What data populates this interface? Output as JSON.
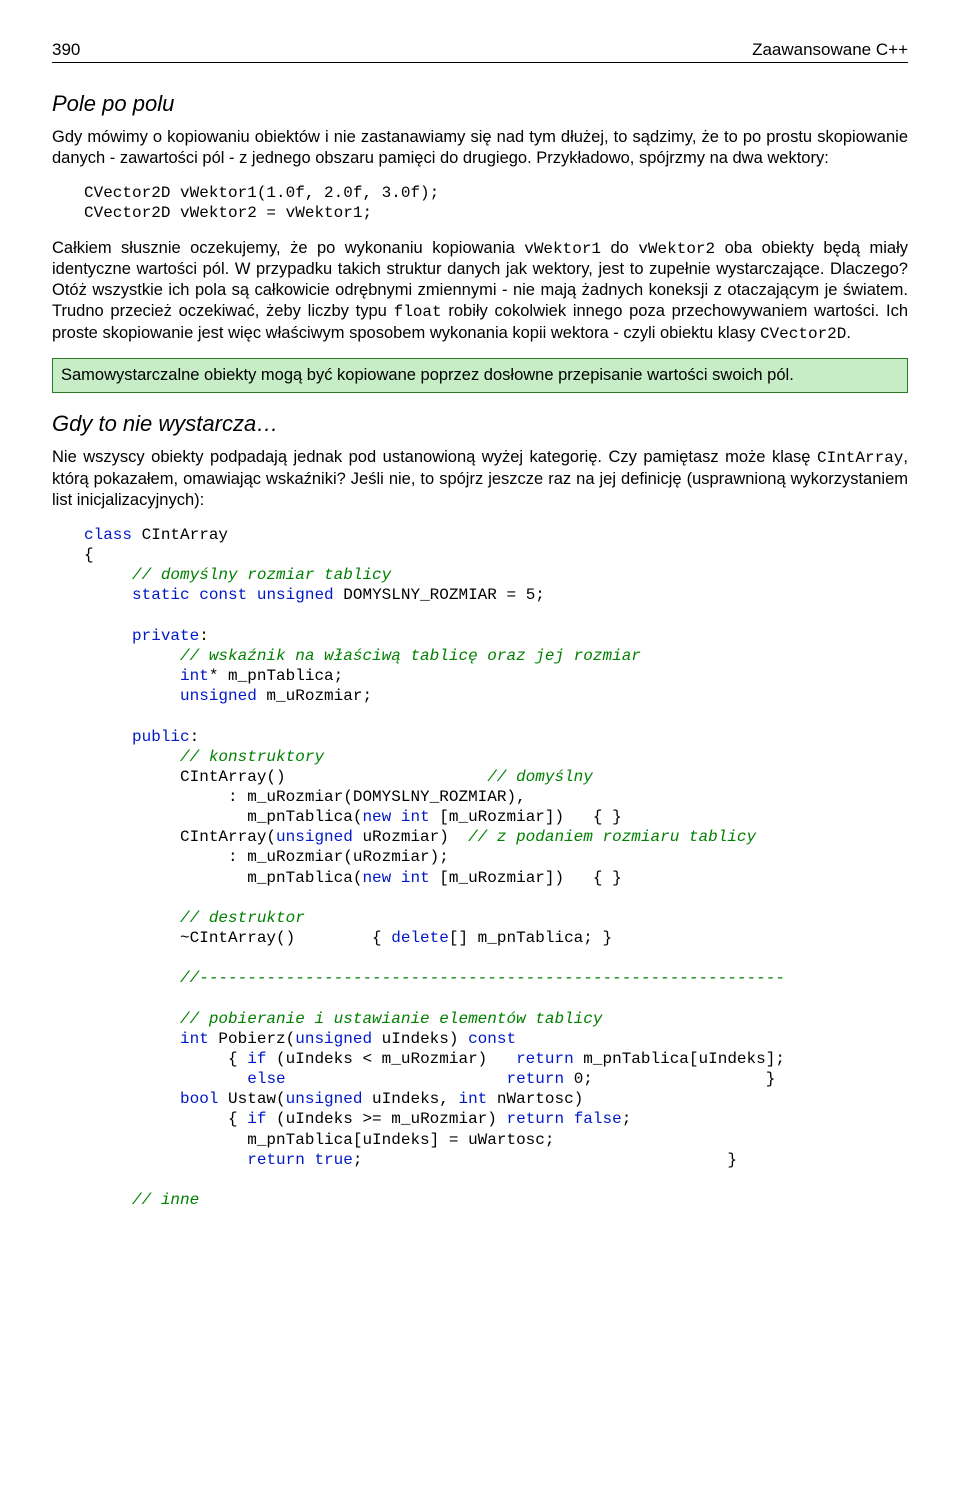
{
  "header": {
    "page_num": "390",
    "title": "Zaawansowane C++"
  },
  "s1": {
    "title": "Pole po polu",
    "p1a": "Gdy mówimy o kopiowaniu obiektów i nie zastanawiamy się nad tym dłużej, to sądzimy, że to po prostu skopiowanie danych - zawartości pól - z jednego obszaru pamięci do drugiego. Przykładowo, spójrzmy na dwa wektory:",
    "code1_l1": "CVector2D vWektor1(1.0f, 2.0f, 3.0f);",
    "code1_l2": "CVector2D vWektor2 = vWektor1;",
    "p2a": "Całkiem słusznie oczekujemy, że po wykonaniu kopiowania ",
    "p2b": "vWektor1",
    "p2c": " do ",
    "p2d": "vWektor2",
    "p2e": " oba obiekty będą miały identyczne wartości pól. W przypadku takich struktur danych jak wektory, jest to zupełnie wystarczające. Dlaczego? Otóż wszystkie ich pola są całkowicie odrębnymi zmiennymi - nie mają żadnych koneksji z otaczającym je światem. Trudno przecież oczekiwać, żeby liczby typu ",
    "p2f": "float",
    "p2g": " robiły cokolwiek innego poza przechowywaniem wartości. Ich proste skopiowanie jest więc właściwym sposobem wykonania kopii wektora - czyli obiektu klasy ",
    "p2h": "CVector2D",
    "p2i": ".",
    "note": "Samowystarczalne obiekty mogą być kopiowane poprzez dosłowne przepisanie wartości swoich pól."
  },
  "s2": {
    "title": "Gdy to nie wystarcza…",
    "p1a": "Nie wszyscy obiekty podpadają jednak pod ustanowioną wyżej kategorię. Czy pamiętasz może klasę ",
    "p1b": "CIntArray",
    "p1c": ", którą pokazałem, omawiając wskaźniki? Jeśli nie, to spójrz jeszcze raz na jej definicję (usprawnioną wykorzystaniem list inicjalizacyjnych):"
  },
  "code2": {
    "l01": "class",
    "l01b": " CIntArray",
    "l02": "{",
    "l03": "     ",
    "l03c": "// domyślny rozmiar tablicy",
    "l04a": "     ",
    "l04b": "static const unsigned",
    "l04c": " DOMYSLNY_ROZMIAR = 5;",
    "l06a": "     ",
    "l06b": "private",
    "l06c": ":",
    "l07": "          ",
    "l07c": "// wskaźnik na właściwą tablicę oraz jej rozmiar",
    "l08a": "          ",
    "l08b": "int",
    "l08c": "* m_pnTablica;",
    "l09a": "          ",
    "l09b": "unsigned",
    "l09c": " m_uRozmiar;",
    "l11a": "     ",
    "l11b": "public",
    "l11c": ":",
    "l12": "          ",
    "l12c": "// konstruktory",
    "l13a": "          CIntArray()                     ",
    "l13c": "// domyślny",
    "l14": "               : m_uRozmiar(DOMYSLNY_ROZMIAR),",
    "l15a": "                 m_pnTablica(",
    "l15b": "new int",
    "l15c": " [m_uRozmiar])   { }",
    "l16a": "          CIntArray(",
    "l16b": "unsigned",
    "l16c": " uRozmiar)  ",
    "l16d": "// z podaniem rozmiaru tablicy",
    "l17": "               : m_uRozmiar(uRozmiar);",
    "l18a": "                 m_pnTablica(",
    "l18b": "new int",
    "l18c": " [m_uRozmiar])   { }",
    "l20": "          ",
    "l20c": "// destruktor",
    "l21a": "          ~CIntArray()        { ",
    "l21b": "delete",
    "l21c": "[] m_pnTablica; }",
    "l23": "          ",
    "l23c": "//-------------------------------------------------------------",
    "l25": "          ",
    "l25c": "// pobieranie i ustawianie elementów tablicy",
    "l26a": "          ",
    "l26b": "int",
    "l26c": " Pobierz(",
    "l26d": "unsigned",
    "l26e": " uIndeks) ",
    "l26f": "const",
    "l27a": "               { ",
    "l27b": "if",
    "l27c": " (uIndeks < m_uRozmiar)   ",
    "l27d": "return",
    "l27e": " m_pnTablica[uIndeks];",
    "l28a": "                 ",
    "l28b": "else",
    "l28c": "                       ",
    "l28d": "return",
    "l28e": " 0;                  }",
    "l29a": "          ",
    "l29b": "bool",
    "l29c": " Ustaw(",
    "l29d": "unsigned",
    "l29e": " uIndeks, ",
    "l29f": "int",
    "l29g": " nWartosc)",
    "l30a": "               { ",
    "l30b": "if",
    "l30c": " (uIndeks >= m_uRozmiar) ",
    "l30d": "return false",
    "l30e": ";",
    "l31": "                 m_pnTablica[uIndeks] = uWartosc;",
    "l32a": "                 ",
    "l32b": "return true",
    "l32c": ";                                      }",
    "l34": "     ",
    "l34c": "// inne"
  }
}
